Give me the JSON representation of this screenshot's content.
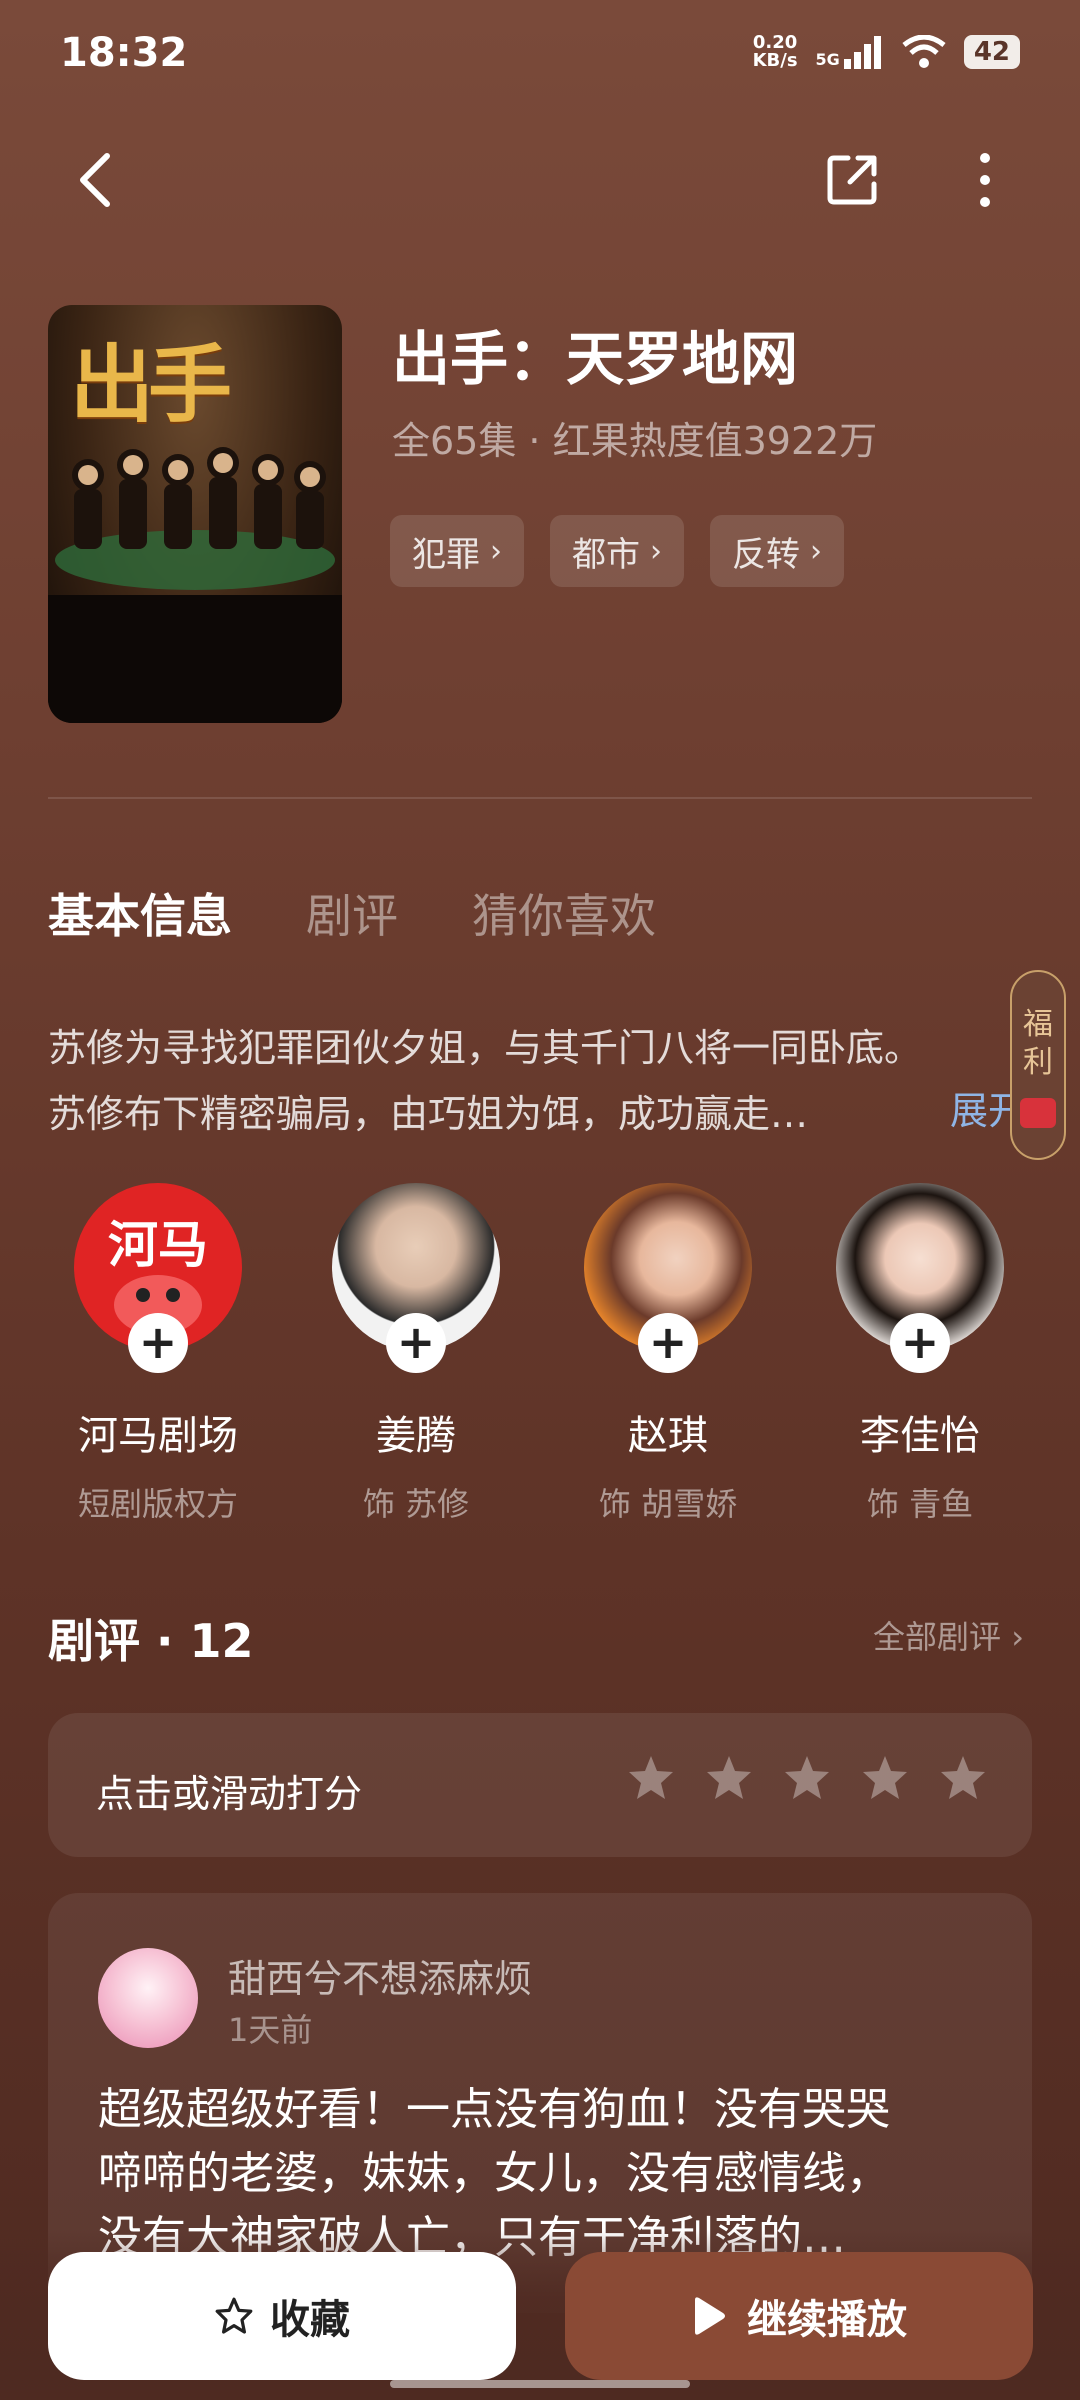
{
  "status_bar": {
    "time": "18:32",
    "net_speed_value": "0.20",
    "net_speed_unit": "KB/s",
    "network": "5G",
    "battery": "42"
  },
  "show": {
    "title": "出手：天罗地网",
    "meta": "全65集 · 红果热度值3922万",
    "tags": [
      "犯罪",
      "都市",
      "反转"
    ],
    "poster_title": "出手"
  },
  "tabs": [
    "基本信息",
    "剧评",
    "猜你喜欢"
  ],
  "synopsis": {
    "line1": "苏修为寻找犯罪团伙夕姐，与其千门八将一同卧底。",
    "line2": "苏修布下精密骗局，由巧姐为饵，成功赢走…",
    "expand": "展开"
  },
  "fuli": {
    "line1": "福",
    "line2": "利"
  },
  "people": [
    {
      "name": "河马剧场",
      "role": "短剧版权方",
      "avatar_text": "河马"
    },
    {
      "name": "姜腾",
      "role": "饰 苏修"
    },
    {
      "name": "赵琪",
      "role": "饰 胡雪娇"
    },
    {
      "name": "李佳怡",
      "role": "饰 青鱼"
    }
  ],
  "reviews": {
    "title": "剧评 · 12",
    "all_link": "全部剧评",
    "rate_prompt": "点击或滑动打分",
    "star_count": 5,
    "items": [
      {
        "user": "甜西兮不想添麻烦",
        "time": "1天前",
        "line1": "超级超级好看！一点没有狗血！没有哭哭",
        "line2": "啼啼的老婆，妹妹，女儿，没有感情线，",
        "line3": "没有大神家破人亡，只有干净利落的…"
      }
    ]
  },
  "actions": {
    "favorite": "收藏",
    "play": "继续播放"
  },
  "colors": {
    "accent": "#8a4a35",
    "link": "#8fb5e6",
    "badge_red": "#e02424"
  }
}
